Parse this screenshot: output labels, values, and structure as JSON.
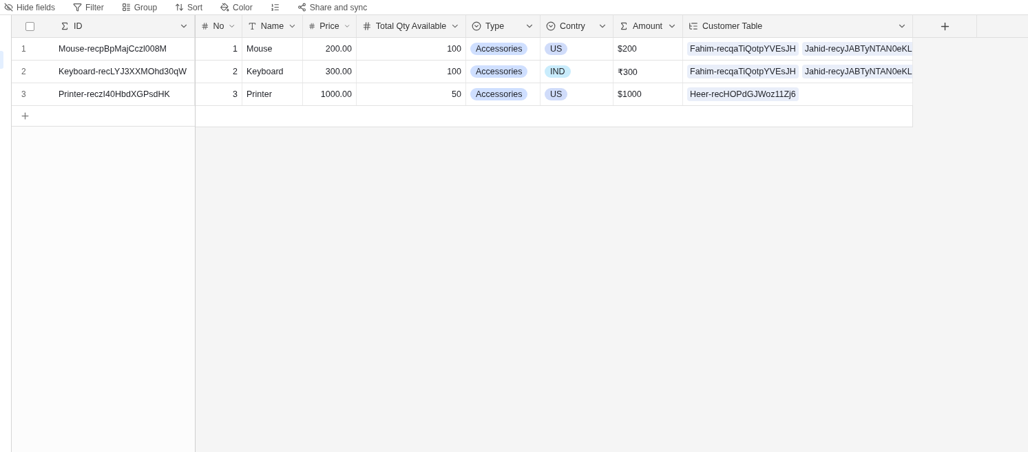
{
  "toolbar": [
    {
      "kind": "hide",
      "label": "Hide fields"
    },
    {
      "kind": "filter",
      "label": "Filter"
    },
    {
      "kind": "group",
      "label": "Group"
    },
    {
      "kind": "sort",
      "label": "Sort"
    },
    {
      "kind": "color",
      "label": "Color"
    },
    {
      "kind": "rowheight"
    },
    {
      "kind": "share",
      "label": "Share and sync"
    }
  ],
  "select_all": {
    "checked": false
  },
  "columns": [
    {
      "name": "ID",
      "kind": "formula"
    },
    {
      "name": "No",
      "kind": "number"
    },
    {
      "name": "Name",
      "kind": "text"
    },
    {
      "name": "Price",
      "kind": "number"
    },
    {
      "name": "Total Qty Available",
      "kind": "number"
    },
    {
      "name": "Type",
      "kind": "select"
    },
    {
      "name": "Contry",
      "kind": "select"
    },
    {
      "name": "Amount",
      "kind": "formula"
    },
    {
      "name": "Customer Table",
      "kind": "link"
    }
  ],
  "rows": [
    {
      "row_number": "1",
      "cells": [
        "Mouse-recpBpMajCczl008M",
        "1",
        "Mouse",
        "200.00",
        "100",
        {
          "label": "Accessories",
          "color": "#cfdfff"
        },
        {
          "label": "US",
          "color": "#d0dcfa"
        },
        "$200",
        [
          "Fahim-recqaTiQotpYVEsJH",
          "Jahid-recyJABTyNTAN0eKL"
        ]
      ]
    },
    {
      "row_number": "2",
      "cells": [
        "Keyboard-recLYJ3XXMOhd30qW",
        "2",
        "Keyboard",
        "300.00",
        "100",
        {
          "label": "Accessories",
          "color": "#cfdfff"
        },
        {
          "label": "IND",
          "color": "#c9ecfc"
        },
        "₹300",
        [
          "Fahim-recqaTiQotpYVEsJH",
          "Jahid-recyJABTyNTAN0eKL"
        ]
      ]
    },
    {
      "row_number": "3",
      "cells": [
        "Printer-reczI40HbdXGPsdHK",
        "3",
        "Printer",
        "1000.00",
        "50",
        {
          "label": "Accessories",
          "color": "#cfdfff"
        },
        {
          "label": "US",
          "color": "#d0dcfa"
        },
        "$1000",
        [
          "Heer-recHOPdGJWoz11Zj6"
        ]
      ]
    }
  ]
}
